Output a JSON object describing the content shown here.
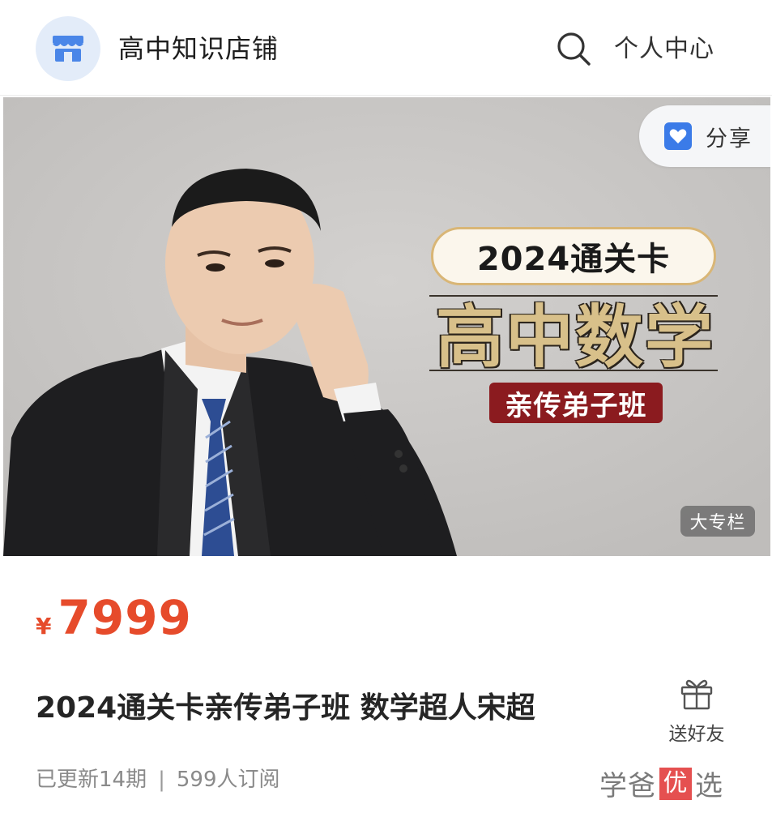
{
  "header": {
    "shop_name": "高中知识店铺",
    "personal_center": "个人中心"
  },
  "banner": {
    "share_label": "分享",
    "promo_pill": "2024通关卡",
    "promo_title": "高中数学",
    "promo_tag": "亲传弟子班",
    "column_badge": "大专栏"
  },
  "product": {
    "price_symbol": "¥",
    "price": "7999",
    "title": "2024通关卡亲传弟子班 数学超人宋超",
    "gift_label": "送好友",
    "updates": "已更新14期",
    "subscribers": "599人订阅"
  },
  "brand": {
    "left": "学爸",
    "mark": "优",
    "right": "选"
  },
  "icons": [
    "shop-icon",
    "search-icon",
    "share-icon",
    "gift-icon"
  ],
  "colors": {
    "price": "#e64b2b",
    "accent_blue": "#3b7be8",
    "banner_bg": "#c9c7c5"
  }
}
